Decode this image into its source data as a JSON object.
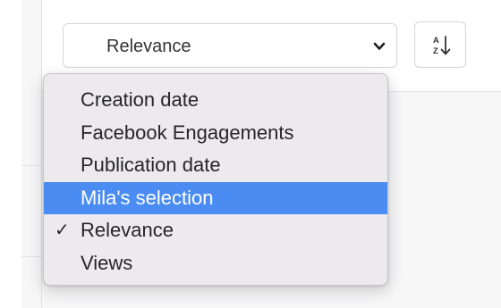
{
  "sort": {
    "selected_label": "Relevance",
    "selected_index": 4,
    "highlighted_index": 3,
    "options": [
      {
        "label": "Creation date"
      },
      {
        "label": "Facebook Engagements"
      },
      {
        "label": "Publication date"
      },
      {
        "label": "Mila's selection"
      },
      {
        "label": "Relevance"
      },
      {
        "label": "Views"
      }
    ]
  },
  "sort_direction": {
    "icon": "sort-alpha-ascending-icon",
    "top_letter": "A",
    "bottom_letter": "Z"
  },
  "icons": {
    "dropdown": "chevron-down-icon",
    "selected_mark": "checkmark-icon"
  },
  "colors": {
    "highlight": "#4a8cf2",
    "menu_background": "#eceaed",
    "panel_background": "#f7f7f8"
  }
}
